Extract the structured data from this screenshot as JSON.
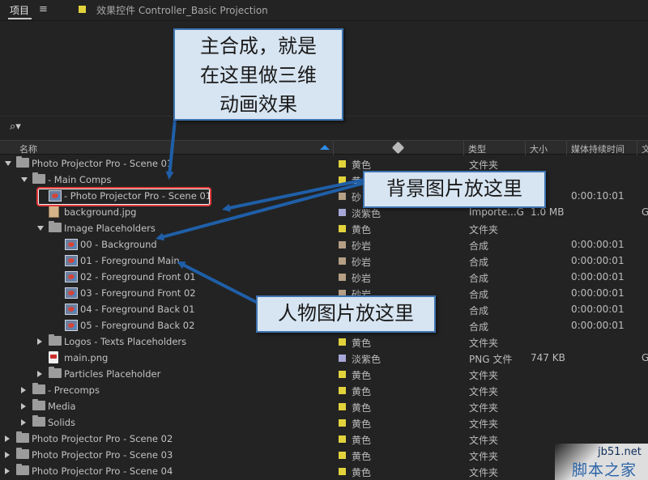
{
  "tabs": {
    "project": "项目",
    "menu_icon": "hamburger-menu-icon",
    "effects": "效果控件 Controller_Basic Projection"
  },
  "search": {
    "icon": "search-icon",
    "glyph": "⌕▾"
  },
  "columns": {
    "name": "名称",
    "type": "类型",
    "size": "大小",
    "duration": "媒体持续时间",
    "extra": "文"
  },
  "colors": {
    "yellow": "#e2d33c",
    "sandstone": "#b59f85",
    "lavender": "#a7a8d8",
    "accent": "#2d8ceb",
    "callout_bg": "#d7e4f1",
    "callout_border": "#3d74b0",
    "highlight": "#e33a3a"
  },
  "rows": [
    {
      "indent": 0,
      "tri": "open",
      "icon": "folder",
      "name": "Photo Projector Pro - Scene 01",
      "color": "yellow",
      "label": "黄色",
      "type": "文件夹",
      "size": "",
      "duration": "",
      "extra": ""
    },
    {
      "indent": 1,
      "tri": "open",
      "icon": "folder",
      "name": "- Main Comps",
      "color": "yellow",
      "label": "黄",
      "type": "",
      "size": "",
      "duration": "",
      "extra": ""
    },
    {
      "indent": 2,
      "tri": "",
      "icon": "comp",
      "name": "- Photo Projector Pro - Scene 01",
      "color": "sandstone",
      "label": "砂",
      "type": "",
      "size": "",
      "duration": "0:00:10:01",
      "extra": ""
    },
    {
      "indent": 2,
      "tri": "",
      "icon": "jpg",
      "name": "background.jpg",
      "color": "lavender",
      "label": "淡紫色",
      "type": "Importe...G",
      "size": "1.0 MB",
      "duration": "",
      "extra": "G"
    },
    {
      "indent": 2,
      "tri": "open",
      "icon": "folder",
      "name": "Image Placeholders",
      "color": "yellow",
      "label": "黄色",
      "type": "文件夹",
      "size": "",
      "duration": "",
      "extra": ""
    },
    {
      "indent": 3,
      "tri": "",
      "icon": "comp",
      "name": "00 - Background",
      "color": "sandstone",
      "label": "砂岩",
      "type": "合成",
      "size": "",
      "duration": "0:00:00:01",
      "extra": ""
    },
    {
      "indent": 3,
      "tri": "",
      "icon": "comp",
      "name": "01 - Foreground Main",
      "color": "sandstone",
      "label": "砂岩",
      "type": "合成",
      "size": "",
      "duration": "0:00:00:01",
      "extra": ""
    },
    {
      "indent": 3,
      "tri": "",
      "icon": "comp",
      "name": "02 - Foreground Front 01",
      "color": "sandstone",
      "label": "砂岩",
      "type": "合成",
      "size": "",
      "duration": "0:00:00:01",
      "extra": ""
    },
    {
      "indent": 3,
      "tri": "",
      "icon": "comp",
      "name": "03 - Foreground Front 02",
      "color": "sandstone",
      "label": "砂岩",
      "type": "合成",
      "size": "",
      "duration": "0:00:00:01",
      "extra": ""
    },
    {
      "indent": 3,
      "tri": "",
      "icon": "comp",
      "name": "04 - Foreground Back 01",
      "color": "sandstone",
      "label": "砂岩",
      "type": "合成",
      "size": "",
      "duration": "0:00:00:01",
      "extra": ""
    },
    {
      "indent": 3,
      "tri": "",
      "icon": "comp",
      "name": "05 - Foreground Back 02",
      "color": "sandstone",
      "label": "砂岩",
      "type": "合成",
      "size": "",
      "duration": "0:00:00:01",
      "extra": ""
    },
    {
      "indent": 2,
      "tri": "closed",
      "icon": "folder",
      "name": "Logos - Texts Placeholders",
      "color": "yellow",
      "label": "黄色",
      "type": "文件夹",
      "size": "",
      "duration": "",
      "extra": ""
    },
    {
      "indent": 2,
      "tri": "",
      "icon": "png",
      "name": "main.png",
      "color": "lavender",
      "label": "淡紫色",
      "type": "PNG 文件",
      "size": "747 KB",
      "duration": "",
      "extra": "G"
    },
    {
      "indent": 2,
      "tri": "closed",
      "icon": "folder",
      "name": "Particles Placeholder",
      "color": "yellow",
      "label": "黄色",
      "type": "文件夹",
      "size": "",
      "duration": "",
      "extra": ""
    },
    {
      "indent": 1,
      "tri": "closed",
      "icon": "folder",
      "name": "- Precomps",
      "color": "yellow",
      "label": "黄色",
      "type": "文件夹",
      "size": "",
      "duration": "",
      "extra": ""
    },
    {
      "indent": 1,
      "tri": "closed",
      "icon": "folder",
      "name": "Media",
      "color": "yellow",
      "label": "黄色",
      "type": "文件夹",
      "size": "",
      "duration": "",
      "extra": ""
    },
    {
      "indent": 1,
      "tri": "closed",
      "icon": "folder",
      "name": "Solids",
      "color": "yellow",
      "label": "黄色",
      "type": "文件夹",
      "size": "",
      "duration": "",
      "extra": ""
    },
    {
      "indent": 0,
      "tri": "closed",
      "icon": "folder",
      "name": "Photo Projector Pro - Scene 02",
      "color": "yellow",
      "label": "黄色",
      "type": "文件夹",
      "size": "",
      "duration": "",
      "extra": ""
    },
    {
      "indent": 0,
      "tri": "closed",
      "icon": "folder",
      "name": "Photo Projector Pro - Scene 03",
      "color": "yellow",
      "label": "黄色",
      "type": "文件夹",
      "size": "",
      "duration": "",
      "extra": ""
    },
    {
      "indent": 0,
      "tri": "closed",
      "icon": "folder",
      "name": "Photo Projector Pro - Scene 04",
      "color": "yellow",
      "label": "黄色",
      "type": "文件夹",
      "size": "",
      "duration": "",
      "extra": ""
    }
  ],
  "callouts": {
    "main_comp": [
      "主合成，就是",
      "在这里做三维",
      "动画效果"
    ],
    "background": "背景图片放这里",
    "people": "人物图片放这里"
  },
  "watermark": {
    "site": "jb51.net",
    "name": "脚本之家"
  }
}
